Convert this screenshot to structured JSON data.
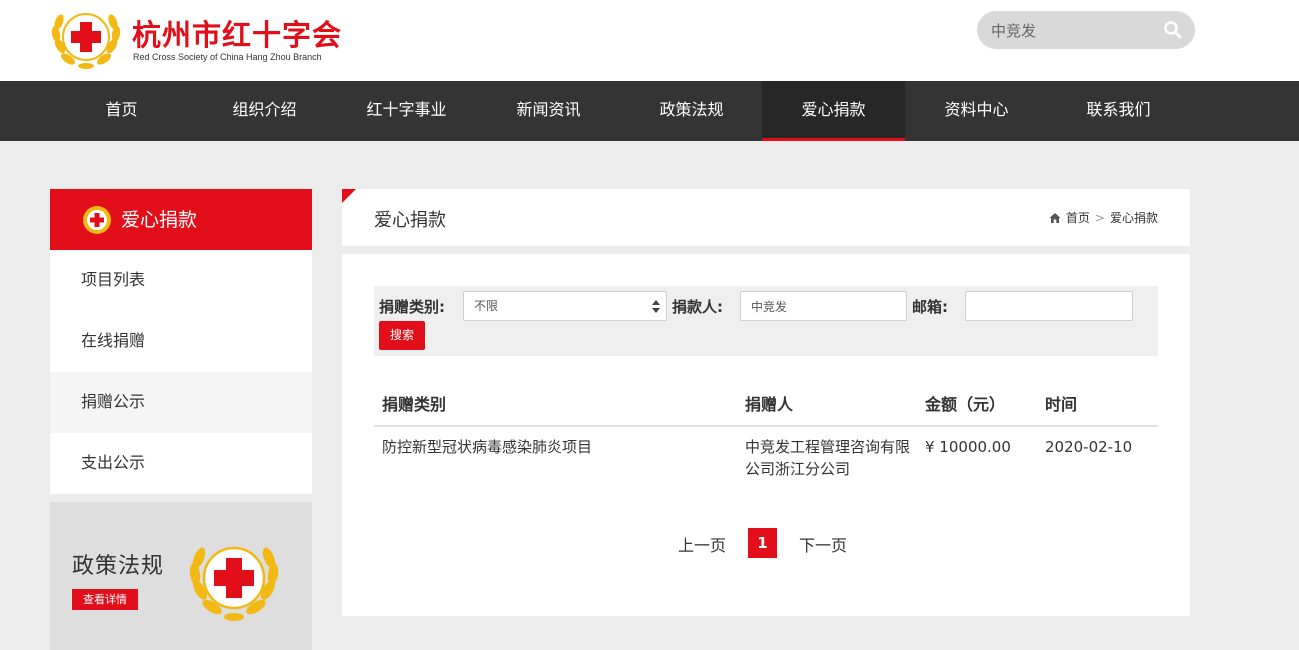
{
  "header": {
    "logo_title": "杭州市红十字会",
    "logo_subtitle": "Red Cross Society of China Hang Zhou Branch",
    "search_value": "中竞发",
    "brand_color": "#e20f1b",
    "search_icon": "search-icon"
  },
  "nav": {
    "items": [
      "首页",
      "组织介绍",
      "红十字事业",
      "新闻资讯",
      "政策法规",
      "爱心捐款",
      "资料中心",
      "联系我们"
    ],
    "active": "爱心捐款"
  },
  "sidebar": {
    "title": "爱心捐款",
    "items": [
      "项目列表",
      "在线捐赠",
      "捐赠公示",
      "支出公示"
    ],
    "current": "捐赠公示",
    "policy": {
      "title": "政策法规",
      "button": "查看详情"
    }
  },
  "main": {
    "title": "爱心捐款",
    "breadcrumb": {
      "home": "首页",
      "separator": ">",
      "current": "爱心捐款"
    },
    "filter": {
      "category_label": "捐赠类别:",
      "category_value": "不限",
      "donor_label": "捐款人:",
      "donor_value": "中竞发",
      "email_label": "邮箱:",
      "email_value": "",
      "search_button": "搜索"
    },
    "table": {
      "headers": [
        "捐赠类别",
        "捐赠人",
        "金额（元）",
        "时间"
      ],
      "rows": [
        [
          "防控新型冠状病毒感染肺炎项目",
          "中竞发工程管理咨询有限公司浙江分公司",
          "¥ 10000.00",
          "2020-02-10"
        ]
      ]
    },
    "pager": {
      "prev": "上一页",
      "current": "1",
      "next": "下一页"
    }
  }
}
